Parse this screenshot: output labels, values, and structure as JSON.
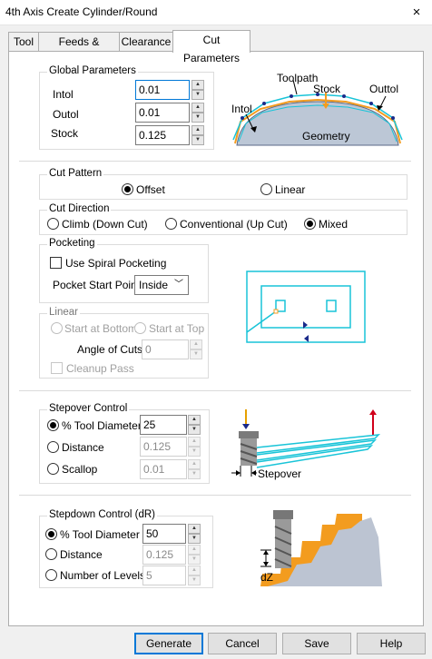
{
  "window": {
    "title": "4th Axis Create Cylinder/Round",
    "close_icon": "×"
  },
  "tabs": [
    {
      "label": "Tool"
    },
    {
      "label": "Feeds & Speeds"
    },
    {
      "label": "Clearance"
    },
    {
      "label": "Cut Parameters"
    }
  ],
  "global": {
    "title": "Global Parameters",
    "intol_label": "Intol",
    "intol_value": "0.01",
    "outol_label": "Outol",
    "outol_value": "0.01",
    "stock_label": "Stock",
    "stock_value": "0.125",
    "diagram": {
      "toolpath": "Toolpath",
      "stock": "Stock",
      "outtol": "Outtol",
      "intol": "Intol",
      "geometry": "Geometry"
    }
  },
  "cut_pattern": {
    "title": "Cut Pattern",
    "offset": "Offset",
    "linear": "Linear",
    "selected": "offset"
  },
  "cut_direction": {
    "title": "Cut Direction",
    "climb": "Climb (Down Cut)",
    "conventional": "Conventional (Up Cut)",
    "mixed": "Mixed",
    "selected": "mixed"
  },
  "pocketing": {
    "title": "Pocketing",
    "spiral": "Use Spiral Pocketing",
    "start_label": "Pocket Start Point",
    "start_value": "Inside"
  },
  "linear": {
    "title": "Linear",
    "bottom": "Start at Bottom",
    "top": "Start at Top",
    "angle_label": "Angle of Cuts",
    "angle_value": "0",
    "cleanup": "Cleanup Pass"
  },
  "stepover": {
    "title": "Stepover Control",
    "tool_label": "% Tool Diameter",
    "tool_value": "25",
    "distance_label": "Distance",
    "distance_value": "0.125",
    "scallop_label": "Scallop",
    "scallop_value": "0.01",
    "diagram_label": "Stepover"
  },
  "stepdown": {
    "title": "Stepdown Control (dR)",
    "tool_label": "% Tool Diameter",
    "tool_value": "50",
    "distance_label": "Distance",
    "distance_value": "0.125",
    "levels_label": "Number of Levels",
    "levels_value": "5",
    "diagram_label": "dZ"
  },
  "buttons": {
    "generate": "Generate",
    "cancel": "Cancel",
    "save": "Save",
    "help": "Help"
  },
  "colors": {
    "accent": "#0078d7",
    "toolpath": "#19c4d8",
    "stock_orange": "#f39c1f",
    "navy": "#1a2a8a"
  }
}
